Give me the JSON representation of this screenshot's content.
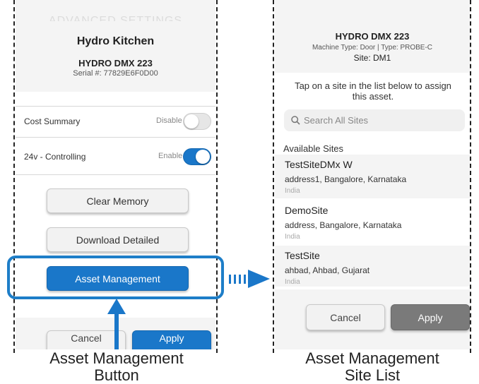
{
  "left_screen": {
    "cropped_header": "ADVANCED SETTINGS",
    "kitchen_name": "Hydro Kitchen",
    "machine_model": "HYDRO DMX 223",
    "serial": "Serial #: 77829E6F0D00",
    "settings": [
      {
        "label": "Cost Summary",
        "state_label": "Disable",
        "enabled": false
      },
      {
        "label": "24v - Controlling",
        "state_label": "Enable",
        "enabled": true
      }
    ],
    "buttons": {
      "clear_memory": "Clear Memory",
      "download_detailed": "Download Detailed",
      "asset_management": "Asset Management"
    },
    "bottom_buttons": {
      "cancel": "Cancel",
      "apply": "Apply"
    }
  },
  "right_screen": {
    "machine_model": "HYDRO DMX 223",
    "machine_type": "Machine Type: Door | Type: PROBE-C",
    "site": "Site: DM1",
    "instruction": "Tap on a site in the list below to assign this asset.",
    "search": {
      "placeholder": "Search All Sites"
    },
    "available_sites_label": "Available Sites",
    "sites": [
      {
        "name": "TestSiteDMx W",
        "address": "address1, Bangalore, Karnataka",
        "country": "India"
      },
      {
        "name": "DemoSite",
        "address": "address, Bangalore, Karnataka",
        "country": "India"
      },
      {
        "name": "TestSite",
        "address": "ahbad, Ahbad, Gujarat",
        "country": "India"
      }
    ],
    "buttons": {
      "cancel": "Cancel",
      "apply": "Apply"
    }
  },
  "captions": {
    "left": [
      "Asset Management",
      "Button"
    ],
    "right": [
      "Asset Management",
      "Site List"
    ]
  },
  "colors": {
    "accent_blue": "#1a77c9",
    "apply_gray": "#7a7a7a"
  }
}
